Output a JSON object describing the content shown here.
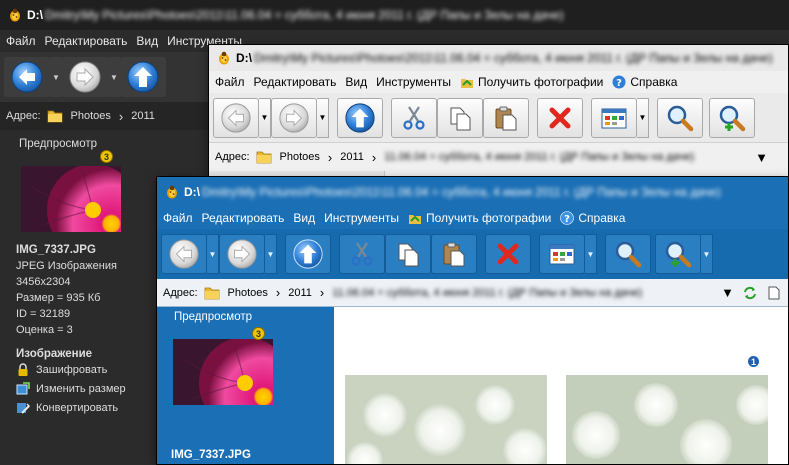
{
  "colors": {
    "dark_bg": "#2b2b2b",
    "blue_accent": "#1b6fb5",
    "badge_yellow": "#f2c400",
    "badge_blue": "#1f5faf"
  },
  "title_drive": "D:\\",
  "menu": {
    "file": "Файл",
    "edit": "Редактировать",
    "view": "Вид",
    "tools": "Инструменты",
    "get_photos": "Получить фотографии",
    "help": "Справка"
  },
  "address": {
    "label": "Адрес:",
    "crumb1": "Photoes",
    "crumb2": "2011"
  },
  "preview_title": "Предпросмотр",
  "thumb_badge": "3",
  "main_badge": "1",
  "image_info": {
    "filename": "IMG_7337.JPG",
    "type": "JPEG Изображения",
    "dimensions": "3456x2304",
    "size": "Размер = 935 Кб",
    "id": "ID = 32189",
    "rating": "Оценка = 3"
  },
  "image_section": {
    "heading": "Изображение",
    "encrypt": "Зашифровать",
    "resize": "Изменить размер",
    "convert": "Конвертировать"
  },
  "blue_filename_cut": "IMG_7337.JPG",
  "icons": [
    "app-bug-icon",
    "back-arrow-icon",
    "forward-arrow-icon",
    "up-arrow-icon",
    "scissors-icon",
    "copy-icon",
    "paste-icon",
    "delete-icon",
    "view-mode-icon",
    "zoom-icon",
    "zoom-in-icon",
    "folder-icon",
    "refresh-icon",
    "help-icon",
    "get-photos-icon",
    "lock-icon",
    "resize-icon",
    "convert-icon"
  ]
}
